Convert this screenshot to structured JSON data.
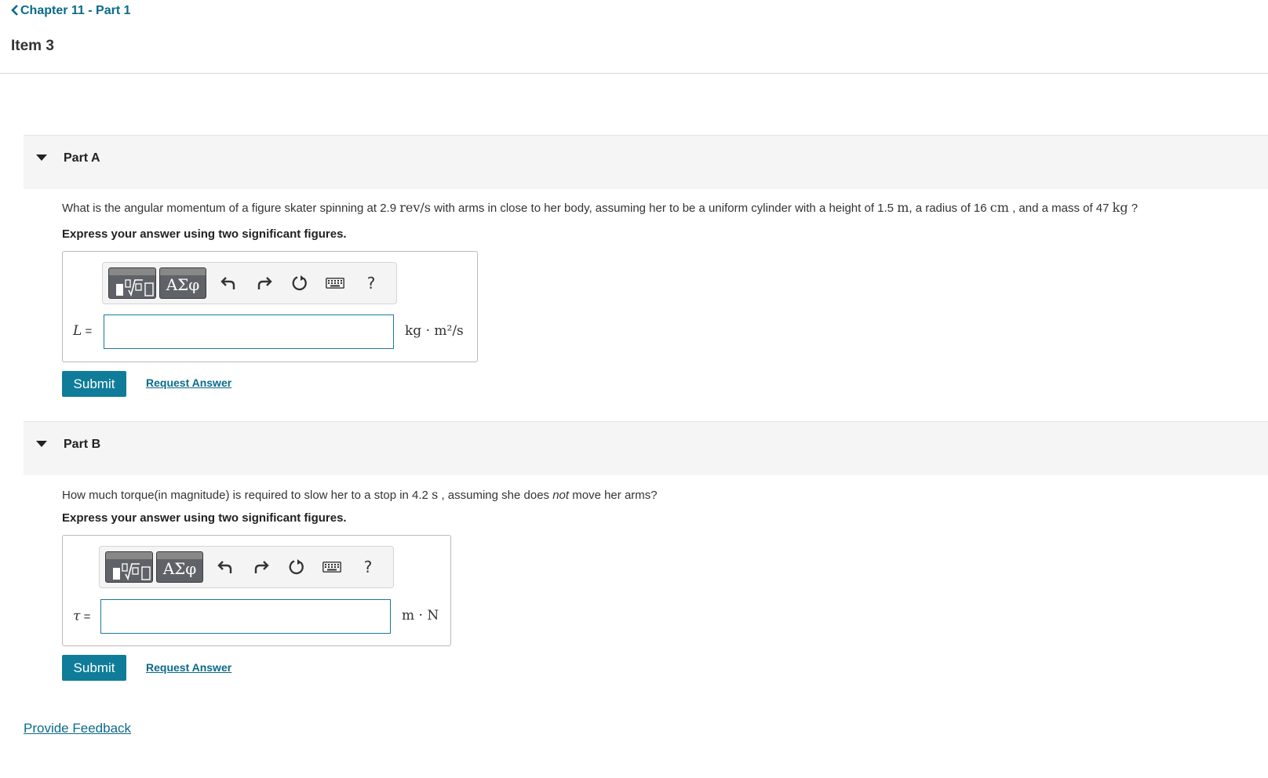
{
  "nav": {
    "back_label": "Chapter 11 - Part 1"
  },
  "item": {
    "title": "Item 3"
  },
  "parts": [
    {
      "header": "Part A",
      "question": {
        "pre": "What is the angular momentum of a figure skater spinning at 2.9 ",
        "unit1": "rev/s",
        "mid1": " with arms in close to her body, assuming her to be a uniform cylinder with a height of 1.5 ",
        "unit2": "m",
        "mid2": ", a radius of 16 ",
        "unit3": "cm",
        "mid3": " , and a mass of 47 ",
        "unit4": "kg",
        "post": " ?"
      },
      "instruction": "Express your answer using two significant figures.",
      "toolbar": {
        "greek_label": "ΑΣφ",
        "help_label": "?"
      },
      "variable": "L",
      "equals": " =",
      "answer_value": "",
      "unit": "kg · m²/s",
      "submit_label": "Submit",
      "request_label": "Request Answer"
    },
    {
      "header": "Part B",
      "question": {
        "pre": "How much torque(in magnitude) is required to slow her to a stop in 4.2 ",
        "unit1": "s",
        "mid1": " , assuming she does ",
        "emph": "not",
        "post": " move her arms?"
      },
      "instruction": "Express your answer using two significant figures.",
      "toolbar": {
        "greek_label": "ΑΣφ",
        "help_label": "?"
      },
      "variable": "τ",
      "equals": " =",
      "answer_value": "",
      "unit": "m · N",
      "submit_label": "Submit",
      "request_label": "Request Answer"
    }
  ],
  "feedback_label": "Provide Feedback",
  "icons": [
    "chevron-left-icon",
    "caret-down-icon",
    "templates-icon",
    "greek-symbols-icon",
    "undo-icon",
    "redo-icon",
    "reset-icon",
    "keyboard-icon",
    "help-icon"
  ],
  "colors": {
    "link": "#0b6a8a",
    "button": "#0f7c99",
    "input_border": "#1b7a99",
    "header_bg": "#f5f5f5"
  }
}
